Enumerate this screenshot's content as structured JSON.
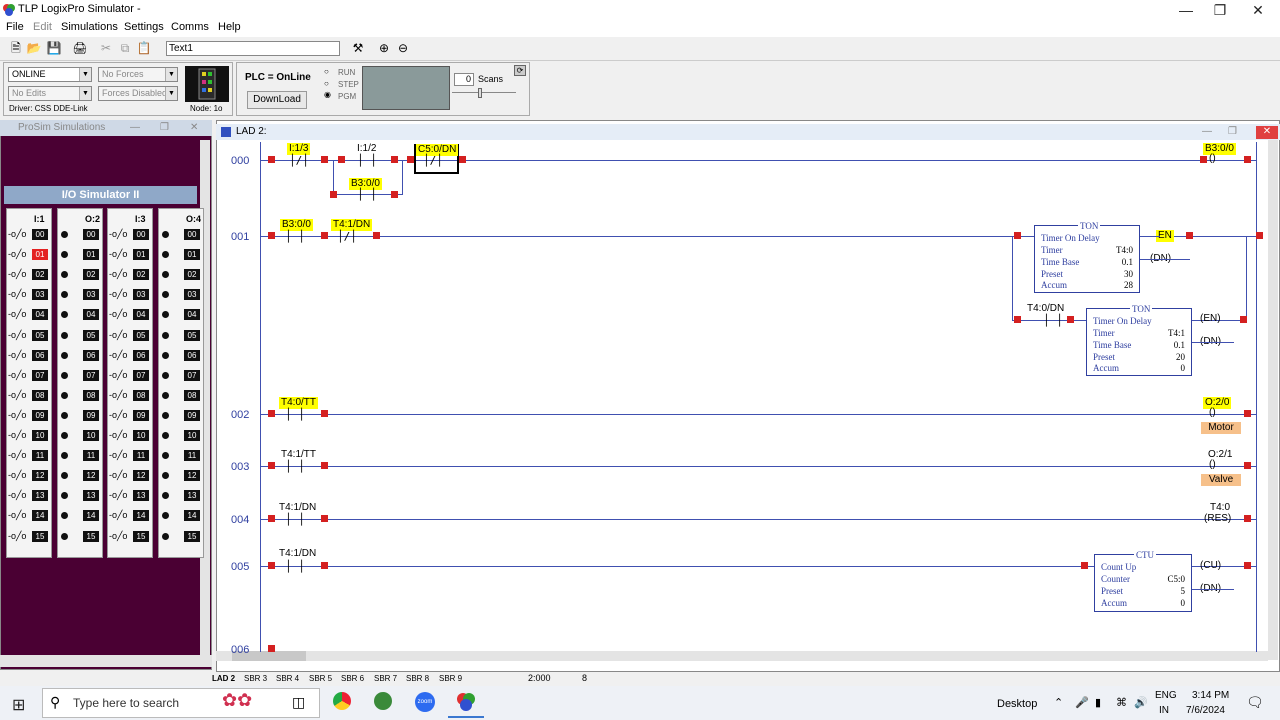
{
  "window": {
    "title": "TLP LogixPro Simulator  -"
  },
  "menu": [
    "File",
    "Edit",
    "Simulations",
    "Settings",
    "Comms",
    "Help"
  ],
  "toolbar": {
    "text_field": "Text1"
  },
  "control": {
    "mode_select": "ONLINE",
    "forces_select": "No Forces",
    "edits_select": "No Edits",
    "forces_disabled": "Forces Disabled",
    "driver": "Driver:  CSS DDE-Link",
    "node": "Node: 1o",
    "plc_status": "PLC = OnLine",
    "download": "DownLoad",
    "run": "RUN",
    "step": "STEP",
    "pgm": "PGM",
    "scans_value": "0",
    "scans_label": "Scans"
  },
  "prosim": {
    "title": "ProSim Simulations",
    "io_title": "I/O Simulator II",
    "columns": [
      "I:1",
      "O:2",
      "I:3",
      "O:4"
    ],
    "rows": [
      "00",
      "01",
      "02",
      "03",
      "04",
      "05",
      "06",
      "07",
      "08",
      "09",
      "10",
      "11",
      "12",
      "13",
      "14",
      "15"
    ],
    "active_input": "01"
  },
  "ladder": {
    "title": "LAD 2:",
    "rungs": [
      "000",
      "001",
      "002",
      "003",
      "004",
      "005",
      "006"
    ],
    "r0": {
      "c1": "I:1/3",
      "c2": "I:1/2",
      "c3": "C5:0/DN",
      "branch": "B3:0/0",
      "coil": "B3:0/0"
    },
    "r1": {
      "c1": "B3:0/0",
      "c2": "T4:1/DN",
      "branch": "T4:0/DN"
    },
    "ton1": {
      "name": "TON",
      "title": "Timer On Delay",
      "timer_l": "Timer",
      "timer": "T4:0",
      "base_l": "Time Base",
      "base": "0.1",
      "preset_l": "Preset",
      "preset": "30",
      "accum_l": "Accum",
      "accum": "28",
      "en": "EN",
      "dn": "DN"
    },
    "ton2": {
      "name": "TON",
      "title": "Timer On Delay",
      "timer_l": "Timer",
      "timer": "T4:1",
      "base_l": "Time Base",
      "base": "0.1",
      "preset_l": "Preset",
      "preset": "20",
      "accum_l": "Accum",
      "accum": "0",
      "en": "EN",
      "dn": "DN"
    },
    "r2": {
      "c1": "T4:0/TT",
      "coil": "O:2/0",
      "label": "Motor"
    },
    "r3": {
      "c1": "T4:1/TT",
      "coil": "O:2/1",
      "label": "Valve"
    },
    "r4": {
      "c1": "T4:1/DN",
      "coil": "T4:0",
      "res": "RES"
    },
    "r5": {
      "c1": "T4:1/DN"
    },
    "ctu": {
      "name": "CTU",
      "title": "Count Up",
      "counter_l": "Counter",
      "counter": "C5:0",
      "preset_l": "Preset",
      "preset": "5",
      "accum_l": "Accum",
      "accum": "0",
      "cu": "CU",
      "dn": "DN"
    }
  },
  "tabs": [
    "LAD 2",
    "SBR 3",
    "SBR 4",
    "SBR 5",
    "SBR 6",
    "SBR 7",
    "SBR 8",
    "SBR 9"
  ],
  "status": {
    "pos": "2:000",
    "val": "8"
  },
  "taskbar": {
    "search": "Type here to search",
    "desktop": "Desktop",
    "lang1": "ENG",
    "lang2": "IN",
    "time": "3:14 PM",
    "date": "7/6/2024"
  }
}
